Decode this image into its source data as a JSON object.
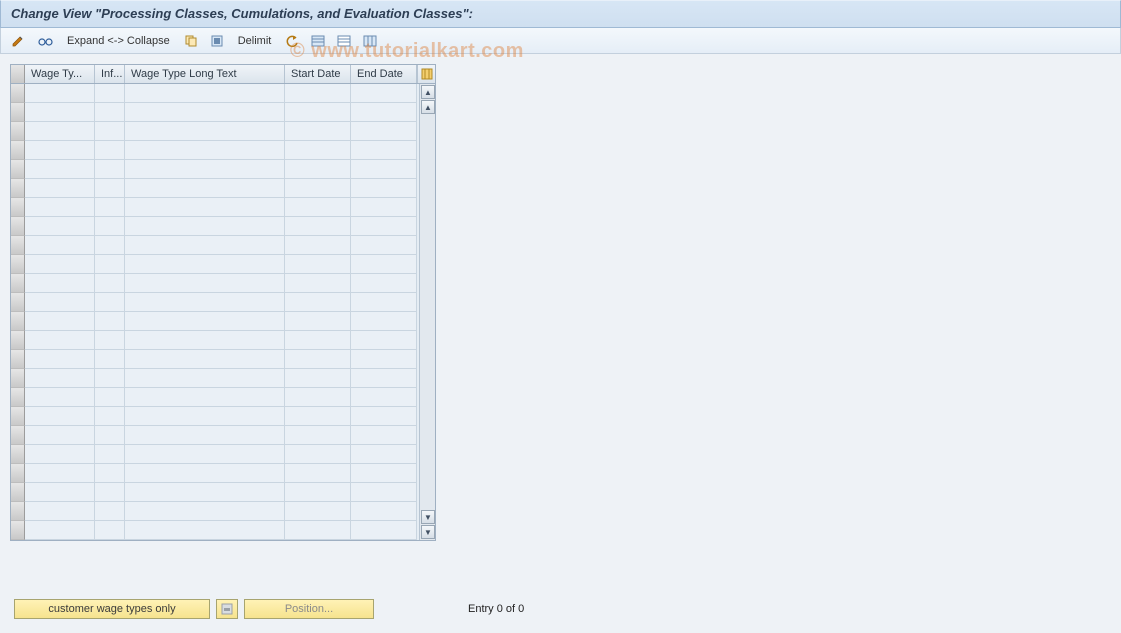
{
  "header": {
    "title": "Change View \"Processing Classes, Cumulations, and Evaluation Classes\":"
  },
  "toolbar": {
    "expand_collapse_label": "Expand <-> Collapse",
    "delimit_label": "Delimit"
  },
  "table": {
    "columns": [
      {
        "label": "Wage Ty...",
        "width_class": "w-wage"
      },
      {
        "label": "Inf...",
        "width_class": "w-inf"
      },
      {
        "label": "Wage Type Long Text",
        "width_class": "w-long"
      },
      {
        "label": "Start Date",
        "width_class": "w-sd"
      },
      {
        "label": "End Date",
        "width_class": "w-ed"
      }
    ],
    "empty_row_count": 24
  },
  "footer": {
    "customer_button_label": "customer wage types only",
    "position_button_label": "Position...",
    "entry_status": "Entry 0 of 0"
  },
  "watermark": "© www.tutorialkart.com"
}
